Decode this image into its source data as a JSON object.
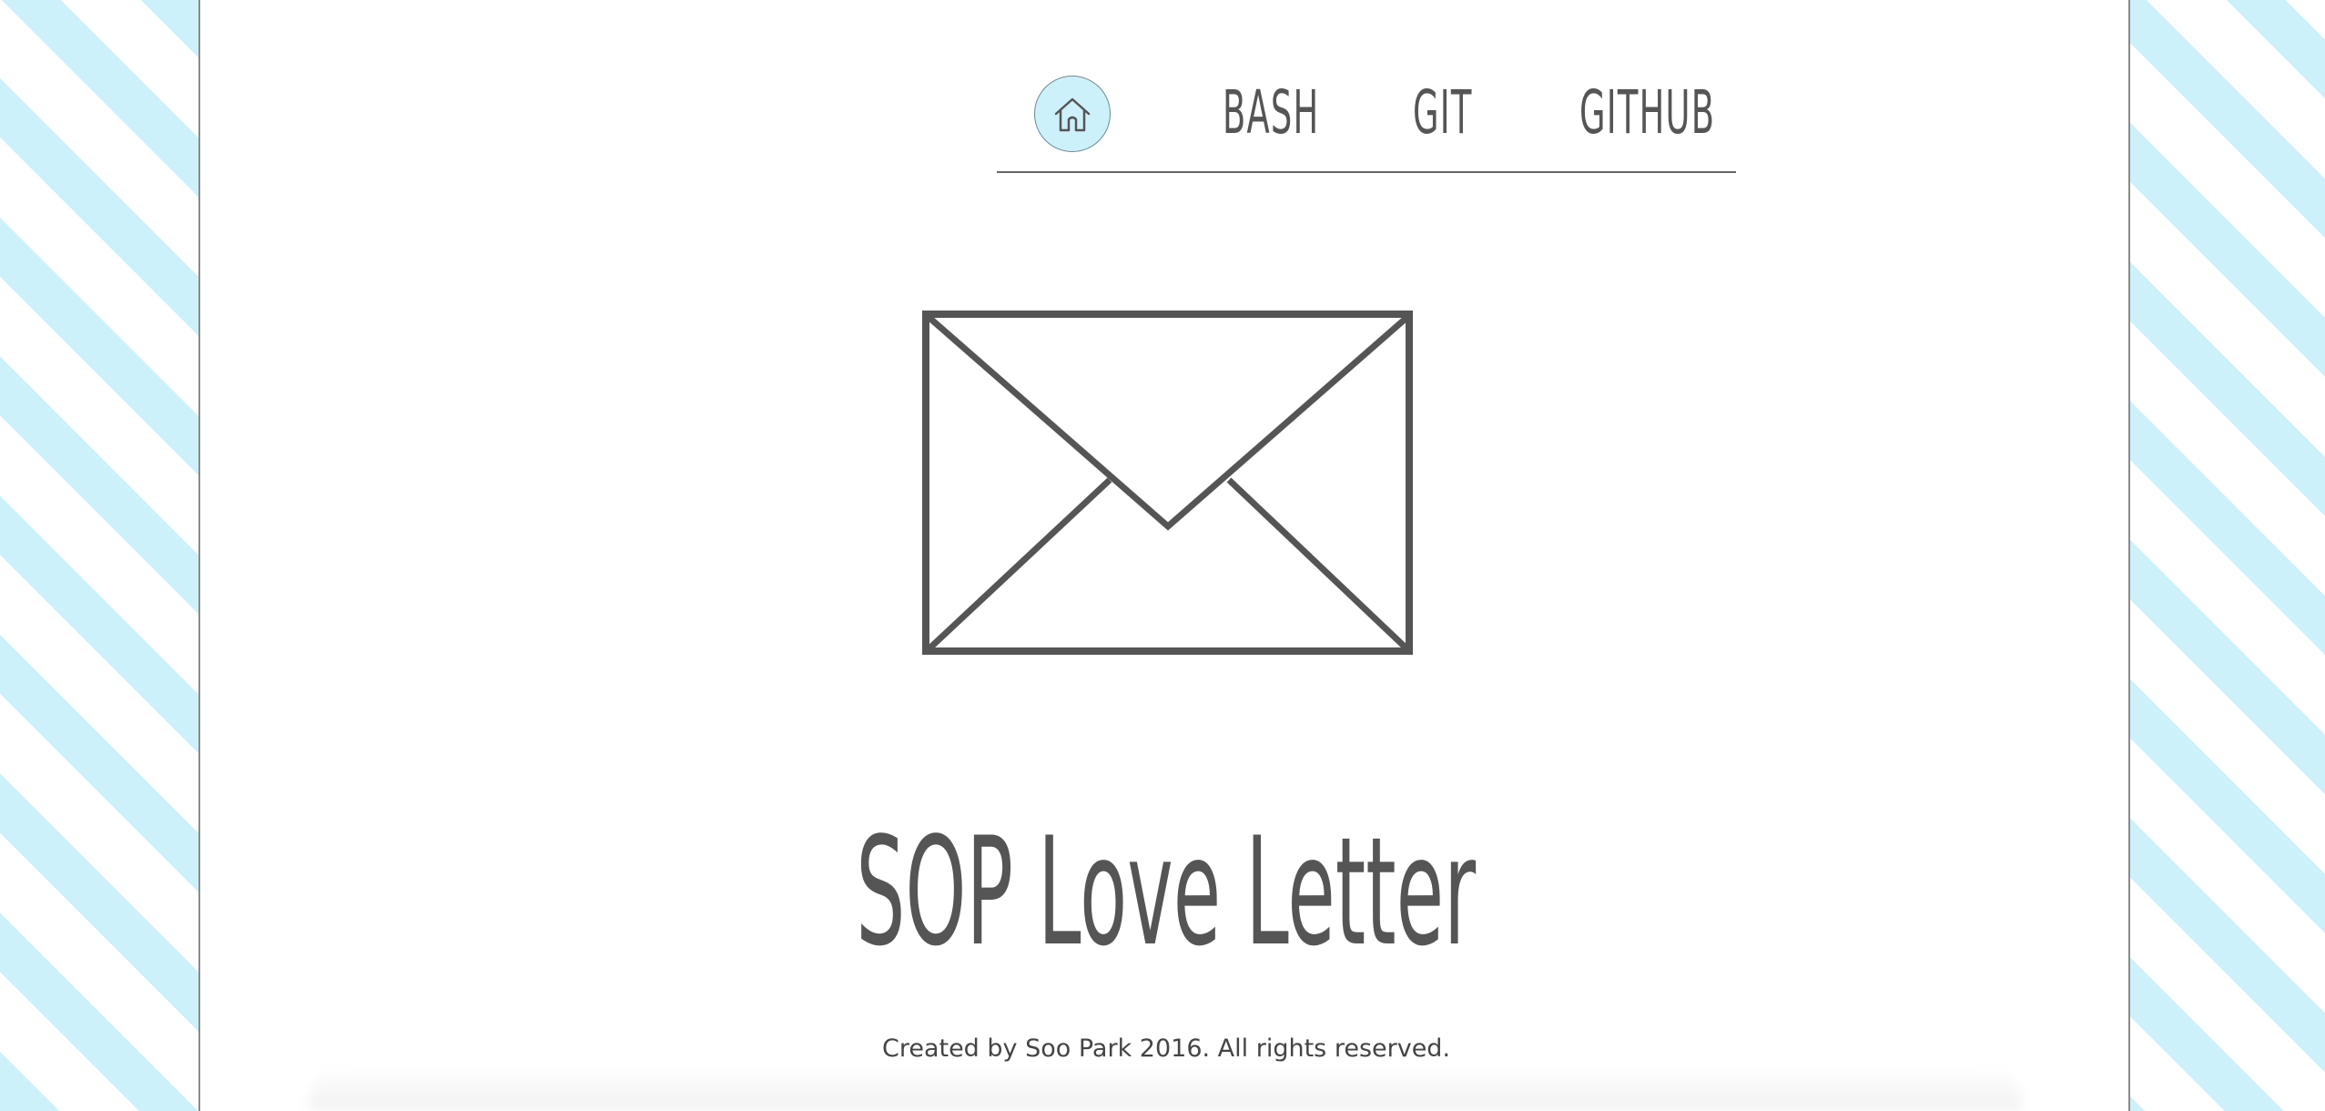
{
  "nav": {
    "home_icon": "home-icon",
    "links": [
      {
        "label": "BASH"
      },
      {
        "label": "GIT"
      },
      {
        "label": "GITHUB"
      }
    ]
  },
  "main": {
    "envelope_icon": "envelope-icon",
    "title": "SOP Love Letter",
    "footer": "Created by Soo Park 2016. All rights reserved."
  },
  "colors": {
    "stripe": "#cdf1fb",
    "text": "#555555",
    "home_button_bg": "#cdf1fb"
  }
}
